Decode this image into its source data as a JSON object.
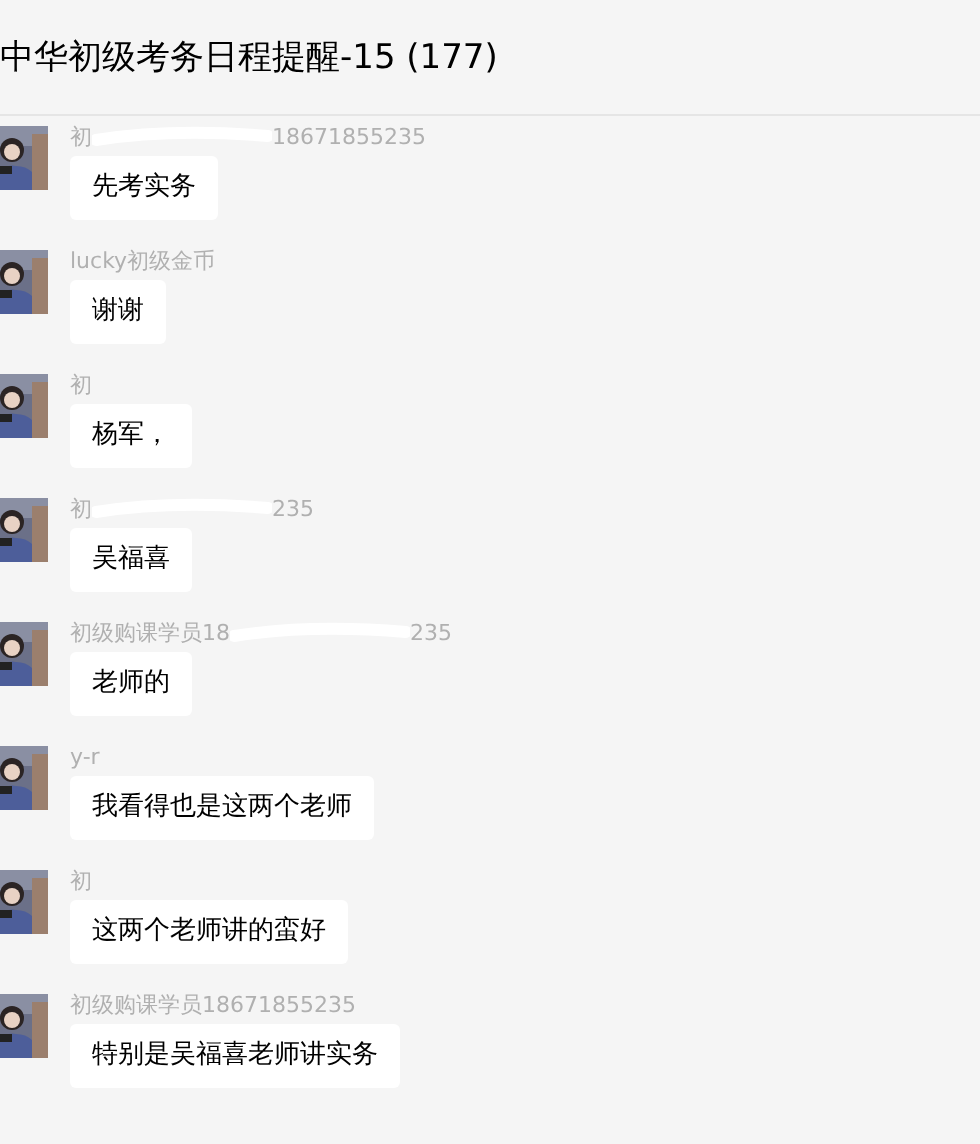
{
  "window": {
    "title": "中华初级考务日程提醒-15 (177)"
  },
  "messages": [
    {
      "name_parts": [
        "初",
        "18671855235"
      ],
      "text": "先考实务"
    },
    {
      "name_parts": [
        "lucky初级金币"
      ],
      "text": "谢谢"
    },
    {
      "name_parts": [
        "初"
      ],
      "text": "杨军，"
    },
    {
      "name_parts": [
        "初",
        "235"
      ],
      "text": "吴福喜"
    },
    {
      "name_parts": [
        "初级购课学员18",
        "235"
      ],
      "text": "老师的"
    },
    {
      "name_parts": [
        "y-r"
      ],
      "text": "我看得也是这两个老师"
    },
    {
      "name_parts": [
        "初"
      ],
      "text": "这两个老师讲的蛮好"
    },
    {
      "name_parts": [
        "初级购课学员18671855235"
      ],
      "text": "特别是吴福喜老师讲实务"
    }
  ]
}
